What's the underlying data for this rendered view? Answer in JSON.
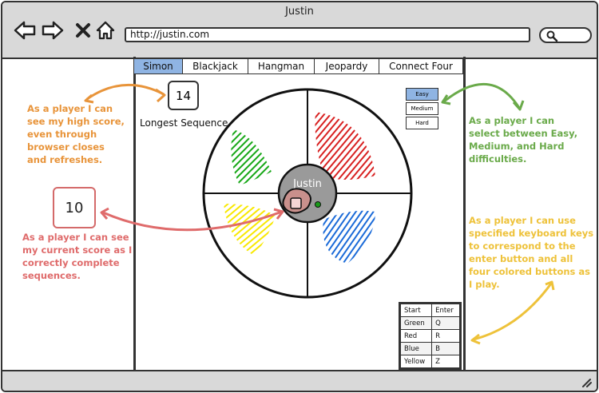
{
  "window": {
    "title": "Justin"
  },
  "browser": {
    "url": "http://justin.com"
  },
  "tabs": [
    {
      "label": "Simon",
      "active": true
    },
    {
      "label": "Blackjack",
      "active": false
    },
    {
      "label": "Hangman",
      "active": false
    },
    {
      "label": "Jeopardy",
      "active": false
    },
    {
      "label": "Connect Four",
      "active": false
    }
  ],
  "high_score": {
    "value": "14",
    "label": "Longest Sequence"
  },
  "current_score": {
    "value": "10"
  },
  "difficulty": {
    "options": [
      "Easy",
      "Medium",
      "Hard"
    ],
    "selected": "Easy"
  },
  "simon": {
    "center_label": "Justin",
    "colors": {
      "green": "#18a818",
      "red": "#d82020",
      "yellow": "#f8e800",
      "blue": "#1a6ad8"
    }
  },
  "notes": {
    "high_score": "As a player I can see my high score, even through browser closes and refreshes.",
    "difficulty": "As a player I can select between Easy, Medium, and Hard difficulties.",
    "current_score": "As a player I can see my current score as I correctly complete sequences.",
    "keys": "As a player I can use specified keyboard keys to correspond to the enter button and all four colored buttons as I play."
  },
  "key_map": {
    "rows": [
      {
        "action": "Start",
        "key": "Enter"
      },
      {
        "action": "Green",
        "key": "Q"
      },
      {
        "action": "Red",
        "key": "R"
      },
      {
        "action": "Blue",
        "key": "B"
      },
      {
        "action": "Yellow",
        "key": "Z"
      }
    ]
  },
  "colors": {
    "orange": "#e8943a",
    "green": "#6aaa4a",
    "red": "#df6b6b",
    "yellow": "#eec23a",
    "accent_blue": "#8fb4e3"
  },
  "icons": [
    "back-arrow-icon",
    "forward-arrow-icon",
    "close-icon",
    "home-icon",
    "search-icon",
    "resize-grip-icon"
  ]
}
